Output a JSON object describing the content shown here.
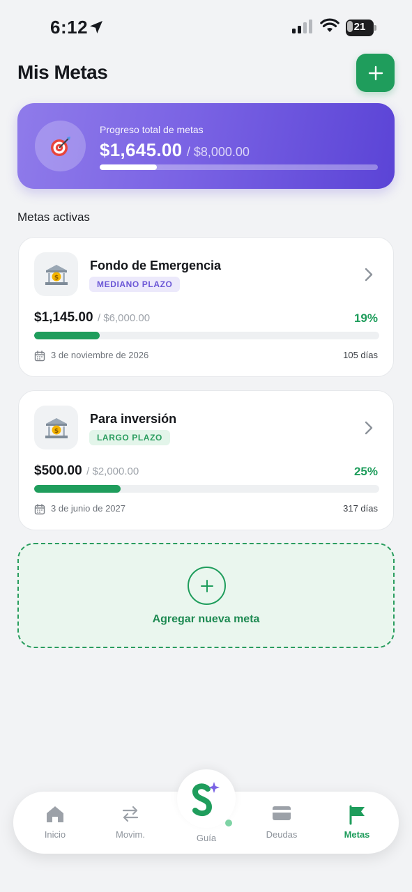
{
  "status_bar": {
    "time": "6:12",
    "battery": "21",
    "battery_level": 0.21
  },
  "header": {
    "title": "Mis Metas"
  },
  "summary": {
    "label": "Progreso total de metas",
    "amount": "$1,645.00",
    "total": "/ $8,000.00",
    "progress": 0.2056,
    "icon": "target-dart-icon"
  },
  "section_title": "Metas activas",
  "goals": [
    {
      "name": "Fondo de Emergencia",
      "badge": "MEDIANO PLAZO",
      "badge_color": "#6b57d6",
      "current": "$1,145.00",
      "total": "/ $6,000.00",
      "percent": "19%",
      "progress": 0.19,
      "date": "3 de noviembre de 2026",
      "days": "105 días",
      "icon": "bank-icon"
    },
    {
      "name": "Para inversión",
      "badge": "LARGO PLAZO",
      "badge_color": "#2a9d5f",
      "current": "$500.00",
      "total": "/ $2,000.00",
      "percent": "25%",
      "progress": 0.25,
      "date": "3 de junio de 2027",
      "days": "317 días",
      "icon": "bank-icon"
    }
  ],
  "add_new": {
    "label": "Agregar nueva meta"
  },
  "nav": {
    "items": [
      {
        "label": "Inicio",
        "icon": "home-icon"
      },
      {
        "label": "Movim.",
        "icon": "transfer-arrows-icon"
      },
      {
        "label": "Guía",
        "icon": "guide-logo-icon"
      },
      {
        "label": "Deudas",
        "icon": "credit-card-icon"
      },
      {
        "label": "Metas",
        "icon": "flag-icon",
        "active": true
      }
    ]
  },
  "colors": {
    "accent": "#1f9d5c",
    "purple": "#7a63e4",
    "background": "#f2f3f5"
  }
}
